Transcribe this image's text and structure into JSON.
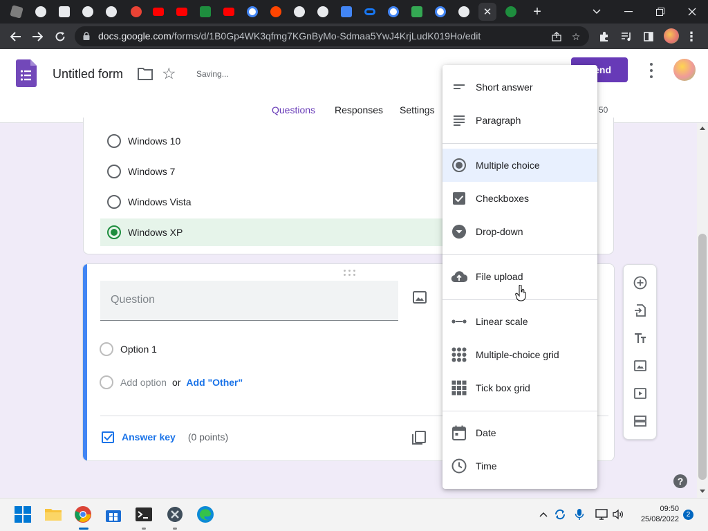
{
  "browser": {
    "url_host": "docs.google.com",
    "url_path": "/forms/d/1B0Gp4WK3qfmg7KGnByMo-Sdmaa5YwJ4KrjLudK019Ho/edit",
    "tab_favicons": [
      "roblox",
      "chrome",
      "calendar",
      "chrome",
      "chrome",
      "record",
      "youtube",
      "youtube",
      "app",
      "youtube",
      "google",
      "reddit",
      "chrome",
      "chrome",
      "docs",
      "meta",
      "google",
      "chat",
      "google",
      "chrome",
      "close",
      "chat"
    ],
    "new_tab_label": "+",
    "tab_close_label": "✕"
  },
  "forms": {
    "title": "Untitled form",
    "status": "Saving...",
    "send_label": "Send",
    "tabs": [
      "Questions",
      "Responses",
      "Settings"
    ],
    "total_points": "ts: 50",
    "accent": "#673ab7"
  },
  "card1": {
    "options": [
      {
        "label": "Windows 10",
        "correct": false
      },
      {
        "label": "Windows 7",
        "correct": false
      },
      {
        "label": "Windows Vista",
        "correct": false
      },
      {
        "label": "Windows XP",
        "correct": true
      }
    ]
  },
  "card2": {
    "question_placeholder": "Question",
    "option1": "Option 1",
    "add_option": "Add option",
    "or": "or",
    "add_other": "Add \"Other\"",
    "answer_key": "Answer key",
    "points": "(0 points)"
  },
  "menu": {
    "items": [
      {
        "label": "Short answer",
        "icon": "short-answer-icon"
      },
      {
        "label": "Paragraph",
        "icon": "paragraph-icon"
      },
      {
        "label": "Multiple choice",
        "icon": "radio-icon",
        "selected": true
      },
      {
        "label": "Checkboxes",
        "icon": "checkbox-icon"
      },
      {
        "label": "Drop-down",
        "icon": "dropdown-icon"
      },
      {
        "label": "File upload",
        "icon": "cloud-upload-icon"
      },
      {
        "label": "Linear scale",
        "icon": "linear-scale-icon"
      },
      {
        "label": "Multiple-choice grid",
        "icon": "grid-dots-icon"
      },
      {
        "label": "Tick box grid",
        "icon": "grid-squares-icon"
      },
      {
        "label": "Date",
        "icon": "calendar-icon"
      },
      {
        "label": "Time",
        "icon": "clock-icon"
      }
    ]
  },
  "taskbar": {
    "time": "09:50",
    "date": "25/08/2022",
    "notifications": "2"
  },
  "help_label": "?"
}
